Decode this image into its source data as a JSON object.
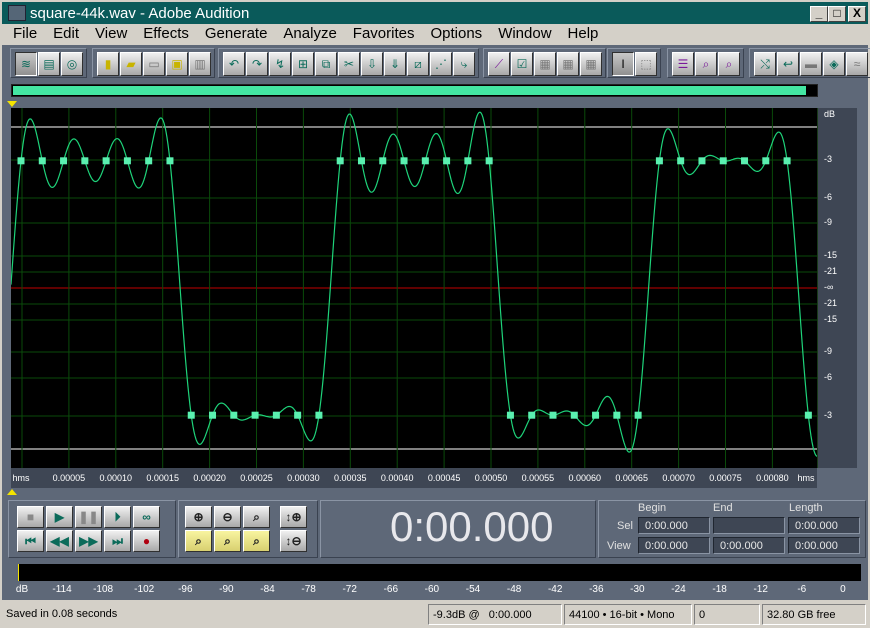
{
  "window": {
    "title": "square-44k.wav - Adobe Audition",
    "minimize": "_",
    "maximize": "□",
    "close": "X"
  },
  "menu": [
    "File",
    "Edit",
    "View",
    "Effects",
    "Generate",
    "Analyze",
    "Favorites",
    "Options",
    "Window",
    "Help"
  ],
  "toolbar_groups": [
    [
      "waveform-view-icon",
      "multitrack-view-icon",
      "cd-view-icon"
    ],
    [
      "new-file-icon",
      "open-file-icon",
      "save-icon",
      "save-as-icon",
      "save-all-icon"
    ],
    [
      "undo-icon",
      "redo-icon",
      "repeat-icon",
      "trim-icon",
      "copy-icon",
      "cut-icon",
      "paste-icon",
      "paste-new-icon",
      "mix-paste-icon",
      "spectral-view-icon",
      "transform-icon"
    ],
    [
      "envelope-icon",
      "checkbox-icon",
      "grid-1-icon",
      "grid-2-icon",
      "grid-3-icon"
    ],
    [
      "time-selection-icon",
      "marquee-selection-icon"
    ],
    [
      "level-meter-icon",
      "frequency-analysis-icon",
      "phase-analysis-icon"
    ],
    [
      "snap-icon",
      "loop-icon",
      "silence-icon",
      "noise-reduction-icon",
      "filter-icon"
    ]
  ],
  "overview": {
    "visible_fraction": 0.985
  },
  "waveform": {
    "time_unit": "hms",
    "time_ticks": [
      "0.00005",
      "0.00010",
      "0.00015",
      "0.00020",
      "0.00025",
      "0.00030",
      "0.00035",
      "0.00040",
      "0.00045",
      "0.00050",
      "0.00055",
      "0.00060",
      "0.00065",
      "0.00070",
      "0.00075",
      "0.00080"
    ],
    "db_unit": "dB",
    "db_ticks": [
      "-3",
      "-6",
      "-9",
      "-15",
      "-21",
      "-∞",
      "-21",
      "-15",
      "-9",
      "-6",
      "-3"
    ],
    "sample_values": [
      0.79,
      0.79,
      0.79,
      0.79,
      0.79,
      0.79,
      0.79,
      0.79,
      -0.79,
      -0.79,
      -0.79,
      -0.79,
      -0.79,
      -0.79,
      -0.79,
      0.79,
      0.79,
      0.79,
      0.79,
      0.79,
      0.79,
      0.79,
      0.79,
      -0.79,
      -0.79,
      -0.79,
      -0.79,
      -0.79,
      -0.79,
      -0.79,
      0.79,
      0.79,
      0.79,
      0.79,
      0.79,
      0.79,
      0.79,
      -0.79
    ],
    "colors": {
      "wave": "#1ed37a",
      "sample": "#5af0b0",
      "center": "#c00000",
      "grid": "#0a4a0a",
      "background": "#000000"
    }
  },
  "transport": {
    "buttons": [
      "stop-icon",
      "play-icon",
      "pause-icon",
      "play-to-end-icon",
      "loop-icon",
      "go-to-start-icon",
      "rewind-icon",
      "fast-forward-icon",
      "go-to-end-icon",
      "record-icon"
    ],
    "glyphs": [
      "■",
      "▶",
      "❚❚",
      "⏵",
      "∞",
      "⏮",
      "◀◀",
      "▶▶",
      "⏭",
      "●"
    ]
  },
  "zoom": {
    "buttons": [
      "zoom-in-icon",
      "zoom-out-icon",
      "zoom-full-icon",
      "zoom-selection-icon",
      "zoom-left-icon",
      "zoom-right-icon",
      "zoom-in-vertical-icon",
      "zoom-out-vertical-icon"
    ]
  },
  "time_display": "0:00.000",
  "selection": {
    "headers": {
      "begin": "Begin",
      "end": "End",
      "length": "Length"
    },
    "sel_label": "Sel",
    "view_label": "View",
    "sel": {
      "begin": "0:00.000",
      "end": "",
      "length": "0:00.000"
    },
    "view": {
      "begin": "0:00.000",
      "end": "0:00.000",
      "length": "0:00.000"
    }
  },
  "level_meter": {
    "labels": [
      "dB",
      "-114",
      "-108",
      "-102",
      "-96",
      "-90",
      "-84",
      "-78",
      "-72",
      "-66",
      "-60",
      "-54",
      "-48",
      "-42",
      "-36",
      "-30",
      "-24",
      "-18",
      "-12",
      "-6",
      "0"
    ]
  },
  "status": {
    "message": "Saved in 0.08 seconds",
    "level": "-9.3dB @   0:00.000",
    "format": "44100 • 16-bit • Mono",
    "value": "0",
    "free": "32.80 GB free"
  }
}
